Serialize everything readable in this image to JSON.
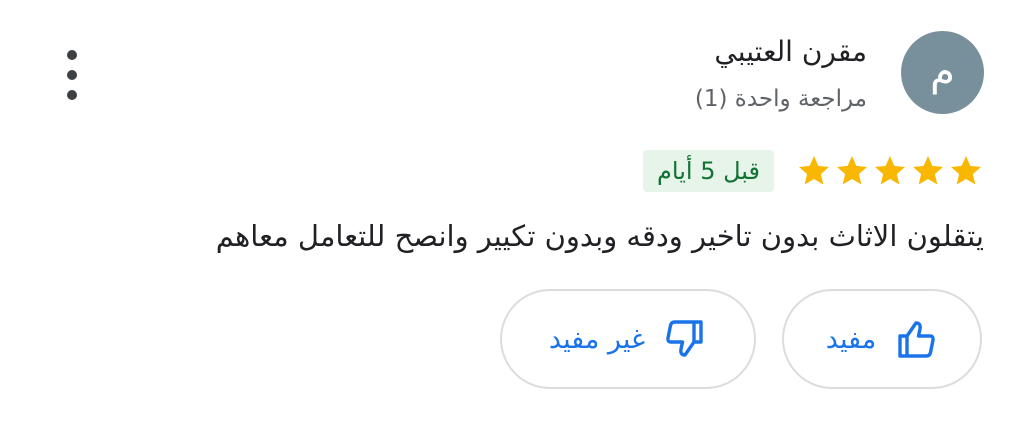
{
  "reviewer": {
    "avatar_letter": "م",
    "name": "مقرن العتيبي",
    "review_count": "مراجعة واحدة (1)"
  },
  "rating": {
    "stars": 5,
    "max_stars": 5,
    "star_color": "#f9b700",
    "time_label": "قبل 5 أيام"
  },
  "review": {
    "text": "يتقلون الاثاث بدون تاخير ودقه وبدون تكيير وانصح للتعامل معاهم"
  },
  "actions": {
    "helpful_label": "مفيد",
    "not_helpful_label": "غير مفيد",
    "icons": {
      "helpful": "thumbs-up-icon",
      "not_helpful": "thumbs-down-icon",
      "menu": "more-vertical-icon"
    }
  },
  "colors": {
    "accent": "#1a73e8",
    "avatar_bg": "#78909c",
    "badge_bg": "#e6f4ea",
    "badge_text": "#137333"
  }
}
